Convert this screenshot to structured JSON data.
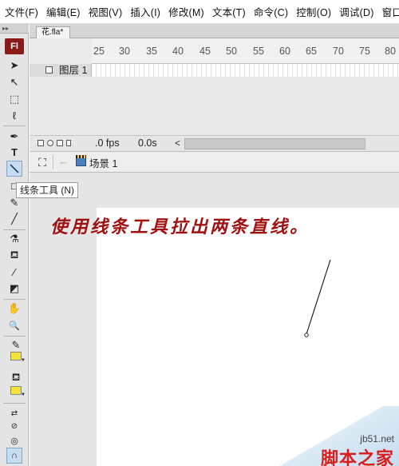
{
  "menubar": {
    "items": [
      "文件(F)",
      "编辑(E)",
      "视图(V)",
      "插入(I)",
      "修改(M)",
      "文本(T)",
      "命令(C)",
      "控制(O)",
      "调试(D)",
      "窗口"
    ]
  },
  "toolbar": {
    "logo_label": "Fl",
    "tools": [
      {
        "name": "selection-tool",
        "glyph": "➤"
      },
      {
        "name": "subselection-tool",
        "glyph": "↖"
      },
      {
        "name": "free-transform-tool",
        "glyph": "⬚"
      },
      {
        "name": "lasso-tool",
        "glyph": "ℓ"
      },
      {
        "name": "pen-tool",
        "glyph": "✒"
      },
      {
        "name": "text-tool",
        "glyph": "T"
      },
      {
        "name": "line-tool",
        "glyph": "\\"
      },
      {
        "name": "rectangle-tool",
        "glyph": "□"
      },
      {
        "name": "pencil-tool",
        "glyph": "✎"
      },
      {
        "name": "brush-tool",
        "glyph": "╱"
      },
      {
        "name": "ink-bottle-tool",
        "glyph": "⚗"
      },
      {
        "name": "paint-bucket-tool",
        "glyph": "⛾"
      },
      {
        "name": "eyedropper-tool",
        "glyph": "⁄"
      },
      {
        "name": "eraser-tool",
        "glyph": "◩"
      },
      {
        "name": "hand-tool",
        "glyph": "✋"
      },
      {
        "name": "zoom-tool",
        "glyph": "🔍"
      }
    ],
    "stroke_color": "#f2e23a",
    "fill_color": "#f2e23a"
  },
  "tooltip": {
    "text": "线条工具 (N)"
  },
  "document": {
    "tab_label": "花.fla*"
  },
  "timeline": {
    "ruler": [
      "25",
      "30",
      "35",
      "40",
      "45",
      "50",
      "55",
      "60",
      "65",
      "70",
      "75",
      "80"
    ],
    "layer_name": "图层 1",
    "fps": ".0 fps",
    "time": "0.0s",
    "scroll_left": "<"
  },
  "editbar": {
    "scene_label": "场景 1"
  },
  "stage": {
    "instruction": "使用线条工具拉出两条直线。",
    "line_color": "#222222"
  },
  "watermark": {
    "url": "jb51.net",
    "brand": "脚本之家"
  },
  "colors": {
    "accent_red": "#a11010",
    "fl_logo": "#8b1a1a",
    "watermark_red": "#d81e1e"
  }
}
